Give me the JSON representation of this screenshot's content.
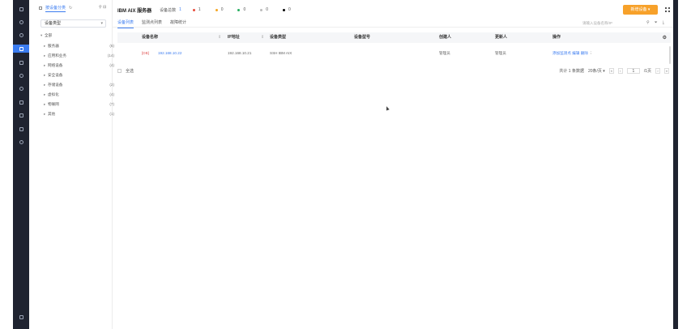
{
  "rail": {
    "items": [
      "apps",
      "monitor",
      "search",
      "list",
      "server",
      "grid",
      "globe",
      "bell",
      "shield",
      "chart",
      "modules",
      "settings"
    ],
    "bottom": "menu"
  },
  "tree": {
    "tab_title": "按设备分类",
    "select_value": "设备类型",
    "nodes": [
      {
        "label": "全部",
        "count": ""
      },
      {
        "label": "服务器",
        "count": "(6)"
      },
      {
        "label": "应用和业务",
        "count": "(14)"
      },
      {
        "label": "网络设备",
        "count": "(4)"
      },
      {
        "label": "安全设备",
        "count": ""
      },
      {
        "label": "存储设备",
        "count": "(2)"
      },
      {
        "label": "虚拟化",
        "count": "(4)"
      },
      {
        "label": "物联网",
        "count": "(7)"
      },
      {
        "label": "其他",
        "count": "(1)"
      }
    ]
  },
  "header": {
    "title": "IBM AIX 服务器",
    "device_count_label": "设备总数",
    "device_count": "1",
    "stats": [
      {
        "value": "1",
        "color": "#e74c3c"
      },
      {
        "value": "0",
        "color": "#f5a623"
      },
      {
        "value": "0",
        "color": "#27ae60"
      },
      {
        "value": "0",
        "color": "#bbbbbb"
      },
      {
        "value": "0",
        "color": "#000000"
      }
    ],
    "add_button": "新增设备"
  },
  "tabs": [
    "设备列表",
    "监测点列表",
    "故障统计"
  ],
  "search": {
    "placeholder": "请输入设备名称/IP"
  },
  "table": {
    "headers": [
      "设备名称",
      "IP地址",
      "设备类型",
      "设备型号",
      "创建人",
      "更新人",
      "操作"
    ],
    "rows": [
      {
        "tag": "[DB]",
        "name": "192.168.10.22",
        "ip": "192.168.10.21",
        "type": "SSH IBM AIX",
        "model": "",
        "creator": "管理员",
        "updater": "管理员",
        "actions": [
          "添加监测点",
          "编辑",
          "删除"
        ]
      }
    ]
  },
  "footer": {
    "select_all": "全选",
    "total": "共计 1 条数据",
    "page_size": "20条/页",
    "page": "1",
    "page_total": "/1页"
  }
}
